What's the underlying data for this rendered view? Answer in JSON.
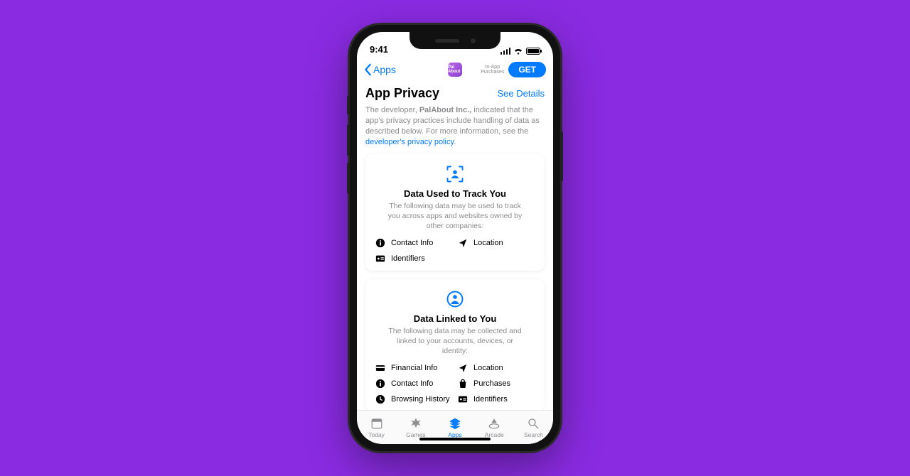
{
  "status": {
    "time": "9:41"
  },
  "nav": {
    "back_label": "Apps",
    "app_icon_text": "Pal About",
    "iap_label": "In-App\nPurchases",
    "get_label": "GET"
  },
  "header": {
    "title": "App Privacy",
    "see_details": "See Details"
  },
  "intro": {
    "prefix": "The developer, ",
    "developer": "PalAbout Inc.,",
    "middle": " indicated that the app's privacy practices include handling of data as described below. For more information, see the ",
    "link": "developer's privacy policy",
    "suffix": "."
  },
  "cards": [
    {
      "title": "Data Used to Track You",
      "subtitle": "The following data may be used to track you across apps and websites owned by other companies:",
      "items": [
        {
          "icon": "info",
          "label": "Contact Info"
        },
        {
          "icon": "location",
          "label": "Location"
        },
        {
          "icon": "id",
          "label": "Identifiers"
        }
      ]
    },
    {
      "title": "Data Linked to You",
      "subtitle": "The following data may be collected and linked to your accounts, devices, or identity:",
      "items": [
        {
          "icon": "card",
          "label": "Financial Info"
        },
        {
          "icon": "location",
          "label": "Location"
        },
        {
          "icon": "info",
          "label": "Contact Info"
        },
        {
          "icon": "bag",
          "label": "Purchases"
        },
        {
          "icon": "clock",
          "label": "Browsing History"
        },
        {
          "icon": "id",
          "label": "Identifiers"
        }
      ]
    }
  ],
  "tabs": [
    {
      "label": "Today"
    },
    {
      "label": "Games"
    },
    {
      "label": "Apps"
    },
    {
      "label": "Arcade"
    },
    {
      "label": "Search"
    }
  ]
}
